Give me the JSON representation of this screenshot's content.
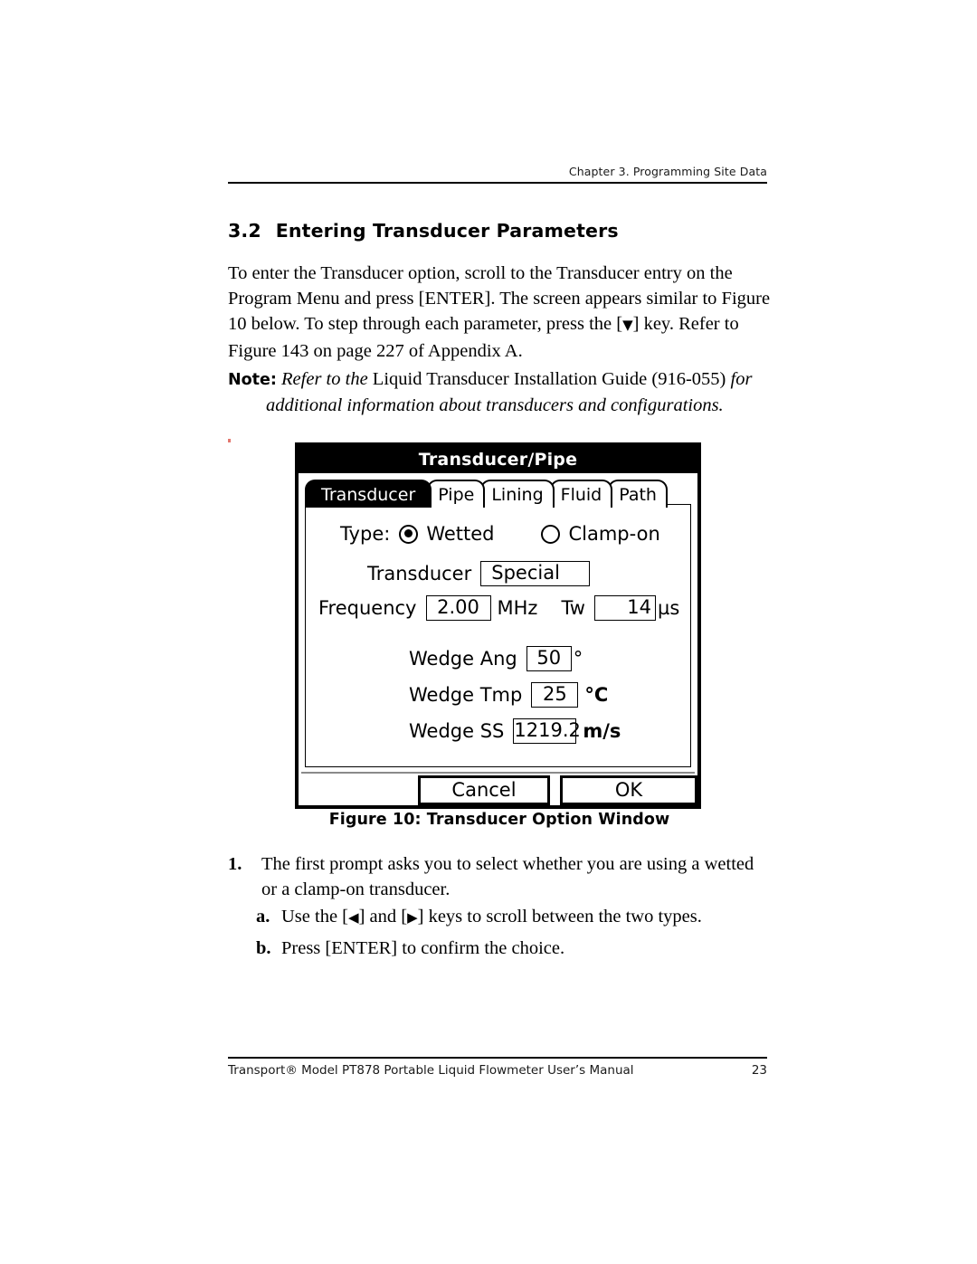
{
  "header": {
    "running_head": "Chapter 3. Programming Site Data"
  },
  "section": {
    "number": "3.2",
    "title": "Entering Transducer Parameters"
  },
  "intro": {
    "part1": "To enter the Transducer option, scroll to the Transducer entry on the Program Menu and press [ENTER]. The screen appears similar to Figure 10 below. To step through each parameter, press the [",
    "down_key": "▼",
    "part2": "] key. Refer to Figure 143 on page 227 of Appendix A."
  },
  "note": {
    "label": "Note:",
    "line1_italic_lead": "Refer to the ",
    "line1_roman": "Liquid Transducer Installation Guide (916-055)",
    "line1_italic_tail": " for",
    "line2": "additional information about transducers and configurations."
  },
  "figure": {
    "caption": "Figure 10: Transducer Option Window",
    "window": {
      "title": "Transducer/Pipe",
      "tabs": [
        {
          "label": "Transducer",
          "active": true
        },
        {
          "label": "Pipe",
          "active": false
        },
        {
          "label": "Lining",
          "active": false
        },
        {
          "label": "Fluid",
          "active": false
        },
        {
          "label": "Path",
          "active": false
        }
      ],
      "type_row": {
        "label": "Type:",
        "options": [
          {
            "label": "Wetted",
            "selected": true
          },
          {
            "label": "Clamp-on",
            "selected": false
          }
        ]
      },
      "fields": [
        {
          "label": "Transducer",
          "value": "Special",
          "unit": ""
        },
        {
          "label": "Frequency",
          "value": "2.00",
          "unit": "MHz"
        },
        {
          "label": "Tw",
          "value": "14",
          "unit": "µs"
        },
        {
          "label": "Wedge Ang",
          "value": "50",
          "unit": "°"
        },
        {
          "label": "Wedge Tmp",
          "value": "25",
          "unit": "°C"
        },
        {
          "label": "Wedge SS",
          "value": "1219.2",
          "unit": "m/s"
        }
      ],
      "buttons": {
        "cancel": "Cancel",
        "ok": "OK"
      }
    }
  },
  "steps": {
    "item1": {
      "marker": "1.",
      "text": "The first prompt asks you to select whether you are using a wetted or a clamp-on transducer."
    },
    "item_a": {
      "marker": "a.",
      "text_before": "Use the [",
      "left_key": "◀",
      "text_middle": "] and [",
      "right_key": "▶",
      "text_after": "] keys to scroll between the two types."
    },
    "item_b": {
      "marker": "b.",
      "text": "Press [ENTER] to confirm the choice."
    }
  },
  "footer": {
    "manual_title": "Transport® Model PT878 Portable Liquid Flowmeter User’s Manual",
    "page_number": "23"
  }
}
